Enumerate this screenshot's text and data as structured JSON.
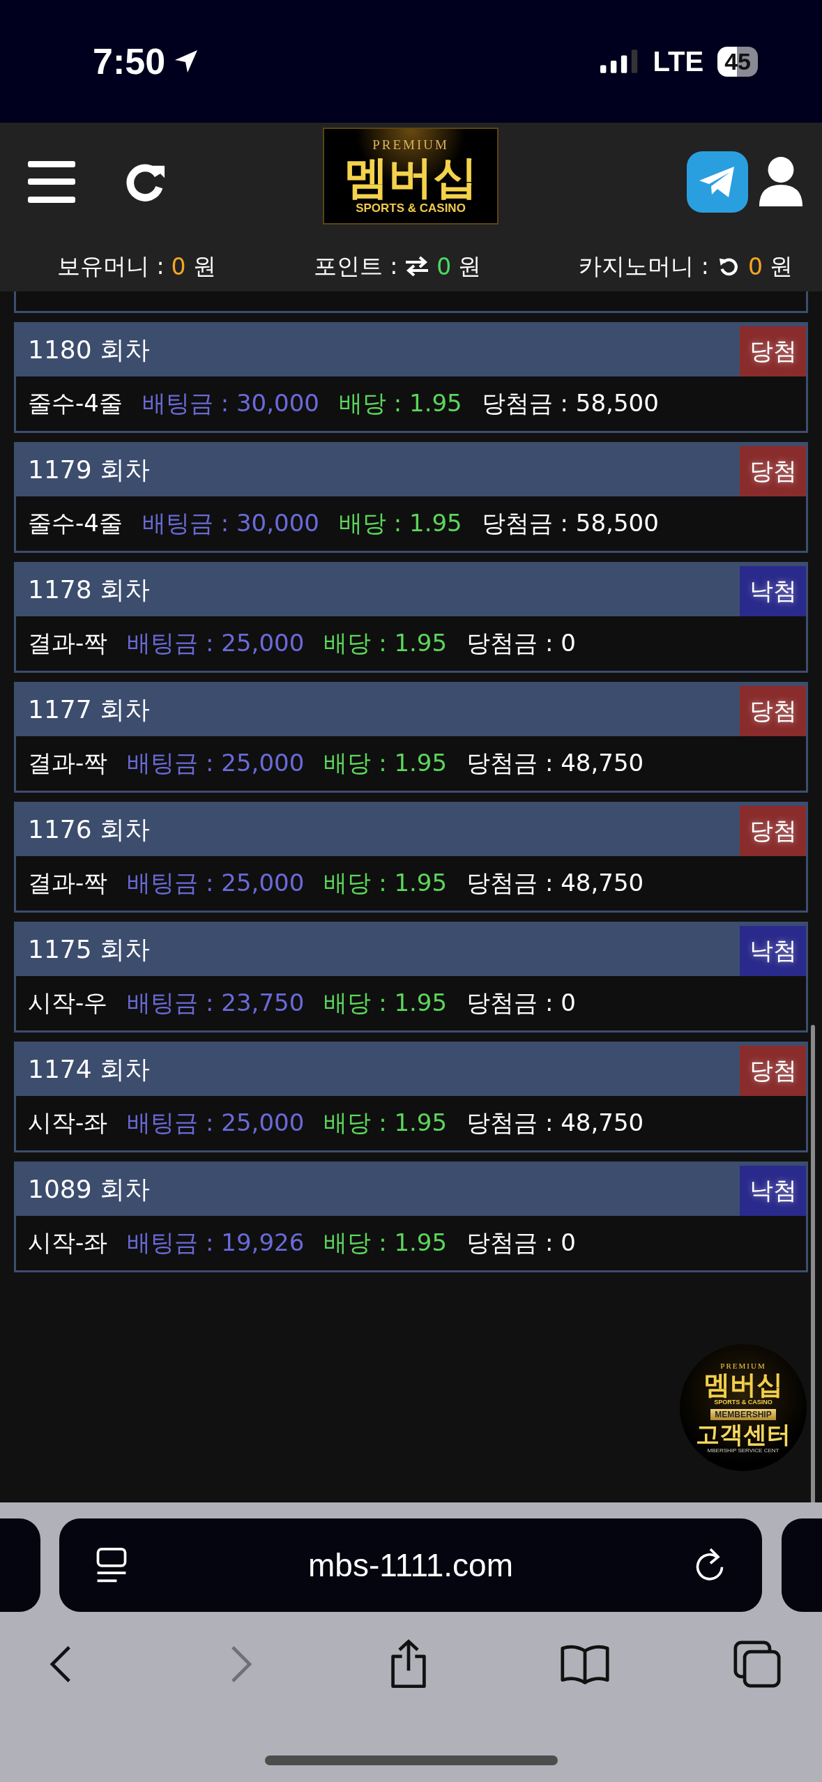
{
  "status_bar": {
    "time": "7:50",
    "network": "LTE",
    "battery": "45"
  },
  "header": {
    "logo": {
      "top": "PREMIUM",
      "main": "멤버십",
      "sub": "SPORTS & CASINO"
    }
  },
  "balances": [
    {
      "label": "보유머니 :",
      "amount": "0",
      "unit": "원",
      "kind": "plain",
      "color": "#f5a623"
    },
    {
      "label": "포인트 :",
      "amount": "0",
      "unit": "원",
      "kind": "transfer",
      "color": "#4cd964"
    },
    {
      "label": "카지노머니 :",
      "amount": "0",
      "unit": "원",
      "kind": "refresh",
      "color": "#f5a623"
    }
  ],
  "bets": [
    {
      "round": "1180 회차",
      "result": "당첨",
      "won": true,
      "pick": "줄수-4줄",
      "stake": "배팅금 : 30,000",
      "odds": "배당 : 1.95",
      "payout": "당첨금 : 58,500"
    },
    {
      "round": "1179 회차",
      "result": "당첨",
      "won": true,
      "pick": "줄수-4줄",
      "stake": "배팅금 : 30,000",
      "odds": "배당 : 1.95",
      "payout": "당첨금 : 58,500"
    },
    {
      "round": "1178 회차",
      "result": "낙첨",
      "won": false,
      "pick": "결과-짝",
      "stake": "배팅금 : 25,000",
      "odds": "배당 : 1.95",
      "payout": "당첨금 : 0"
    },
    {
      "round": "1177 회차",
      "result": "당첨",
      "won": true,
      "pick": "결과-짝",
      "stake": "배팅금 : 25,000",
      "odds": "배당 : 1.95",
      "payout": "당첨금 : 48,750"
    },
    {
      "round": "1176 회차",
      "result": "당첨",
      "won": true,
      "pick": "결과-짝",
      "stake": "배팅금 : 25,000",
      "odds": "배당 : 1.95",
      "payout": "당첨금 : 48,750"
    },
    {
      "round": "1175 회차",
      "result": "낙첨",
      "won": false,
      "pick": "시작-우",
      "stake": "배팅금 : 23,750",
      "odds": "배당 : 1.95",
      "payout": "당첨금 : 0"
    },
    {
      "round": "1174 회차",
      "result": "당첨",
      "won": true,
      "pick": "시작-좌",
      "stake": "배팅금 : 25,000",
      "odds": "배당 : 1.95",
      "payout": "당첨금 : 48,750"
    },
    {
      "round": "1089 회차",
      "result": "낙첨",
      "won": false,
      "pick": "시작-좌",
      "stake": "배팅금 : 19,926",
      "odds": "배당 : 1.95",
      "payout": "당첨금 : 0"
    }
  ],
  "support_badge": {
    "top": "PREMIUM",
    "main": "멤버십",
    "sub": "SPORTS & CASINO",
    "ribbon": "MEMBERSHIP",
    "title": "고객센터",
    "footer": "MBERSHIP SERVICE CENT"
  },
  "browser": {
    "url": "mbs-1111.com"
  }
}
